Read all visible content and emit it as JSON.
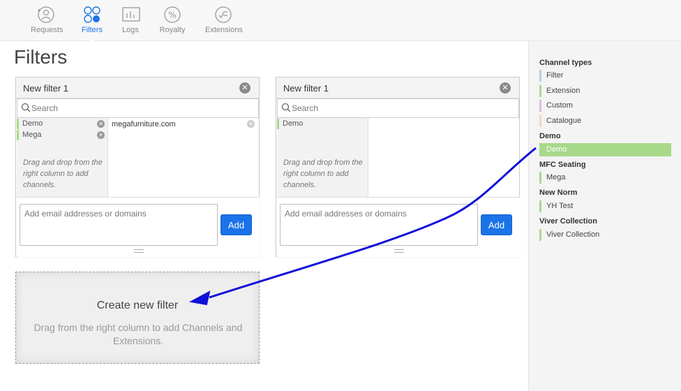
{
  "nav": {
    "items": [
      {
        "label": "Requests",
        "icon": "requests-icon",
        "active": false
      },
      {
        "label": "Filters",
        "icon": "filters-icon",
        "active": true
      },
      {
        "label": "Logs",
        "icon": "logs-icon",
        "active": false
      },
      {
        "label": "Royalty",
        "icon": "royalty-icon",
        "active": false
      },
      {
        "label": "Extensions",
        "icon": "extensions-icon",
        "active": false
      }
    ]
  },
  "page": {
    "title": "Filters"
  },
  "filters": [
    {
      "title": "New filter 1",
      "search_placeholder": "Search",
      "channels": [
        "Demo",
        "Mega"
      ],
      "hint": "Drag and drop from the right column to add channels.",
      "domains": [
        "megafurniture.com"
      ],
      "email_placeholder": "Add email addresses or domains",
      "add_label": "Add"
    },
    {
      "title": "New filter 1",
      "search_placeholder": "Search",
      "channels": [
        "Demo"
      ],
      "hint": "Drag and drop from the right column to add channels.",
      "domains": [],
      "email_placeholder": "Add email addresses or domains",
      "add_label": "Add"
    }
  ],
  "create": {
    "title": "Create new filter",
    "subtitle": "Drag from the right column to add Channels and Extensions."
  },
  "sidebar": {
    "channel_types_title": "Channel types",
    "types": [
      {
        "label": "Filter",
        "color": "#b9cdea"
      },
      {
        "label": "Extension",
        "color": "#a8d98a"
      },
      {
        "label": "Custom",
        "color": "#dcb8ec"
      },
      {
        "label": "Catalogue",
        "color": "#f4d6c8"
      }
    ],
    "groups": [
      {
        "name": "Demo",
        "items": [
          "Demo"
        ]
      },
      {
        "name": "MFC Seating",
        "items": [
          "Mega"
        ]
      },
      {
        "name": "New Norm",
        "items": [
          "YH Test"
        ]
      },
      {
        "name": "Viver Collection",
        "items": [
          "Viver Collection"
        ]
      }
    ]
  },
  "colors": {
    "accent": "#1a73e8",
    "extension": "#a8d98a",
    "arrow": "#1010d8"
  }
}
